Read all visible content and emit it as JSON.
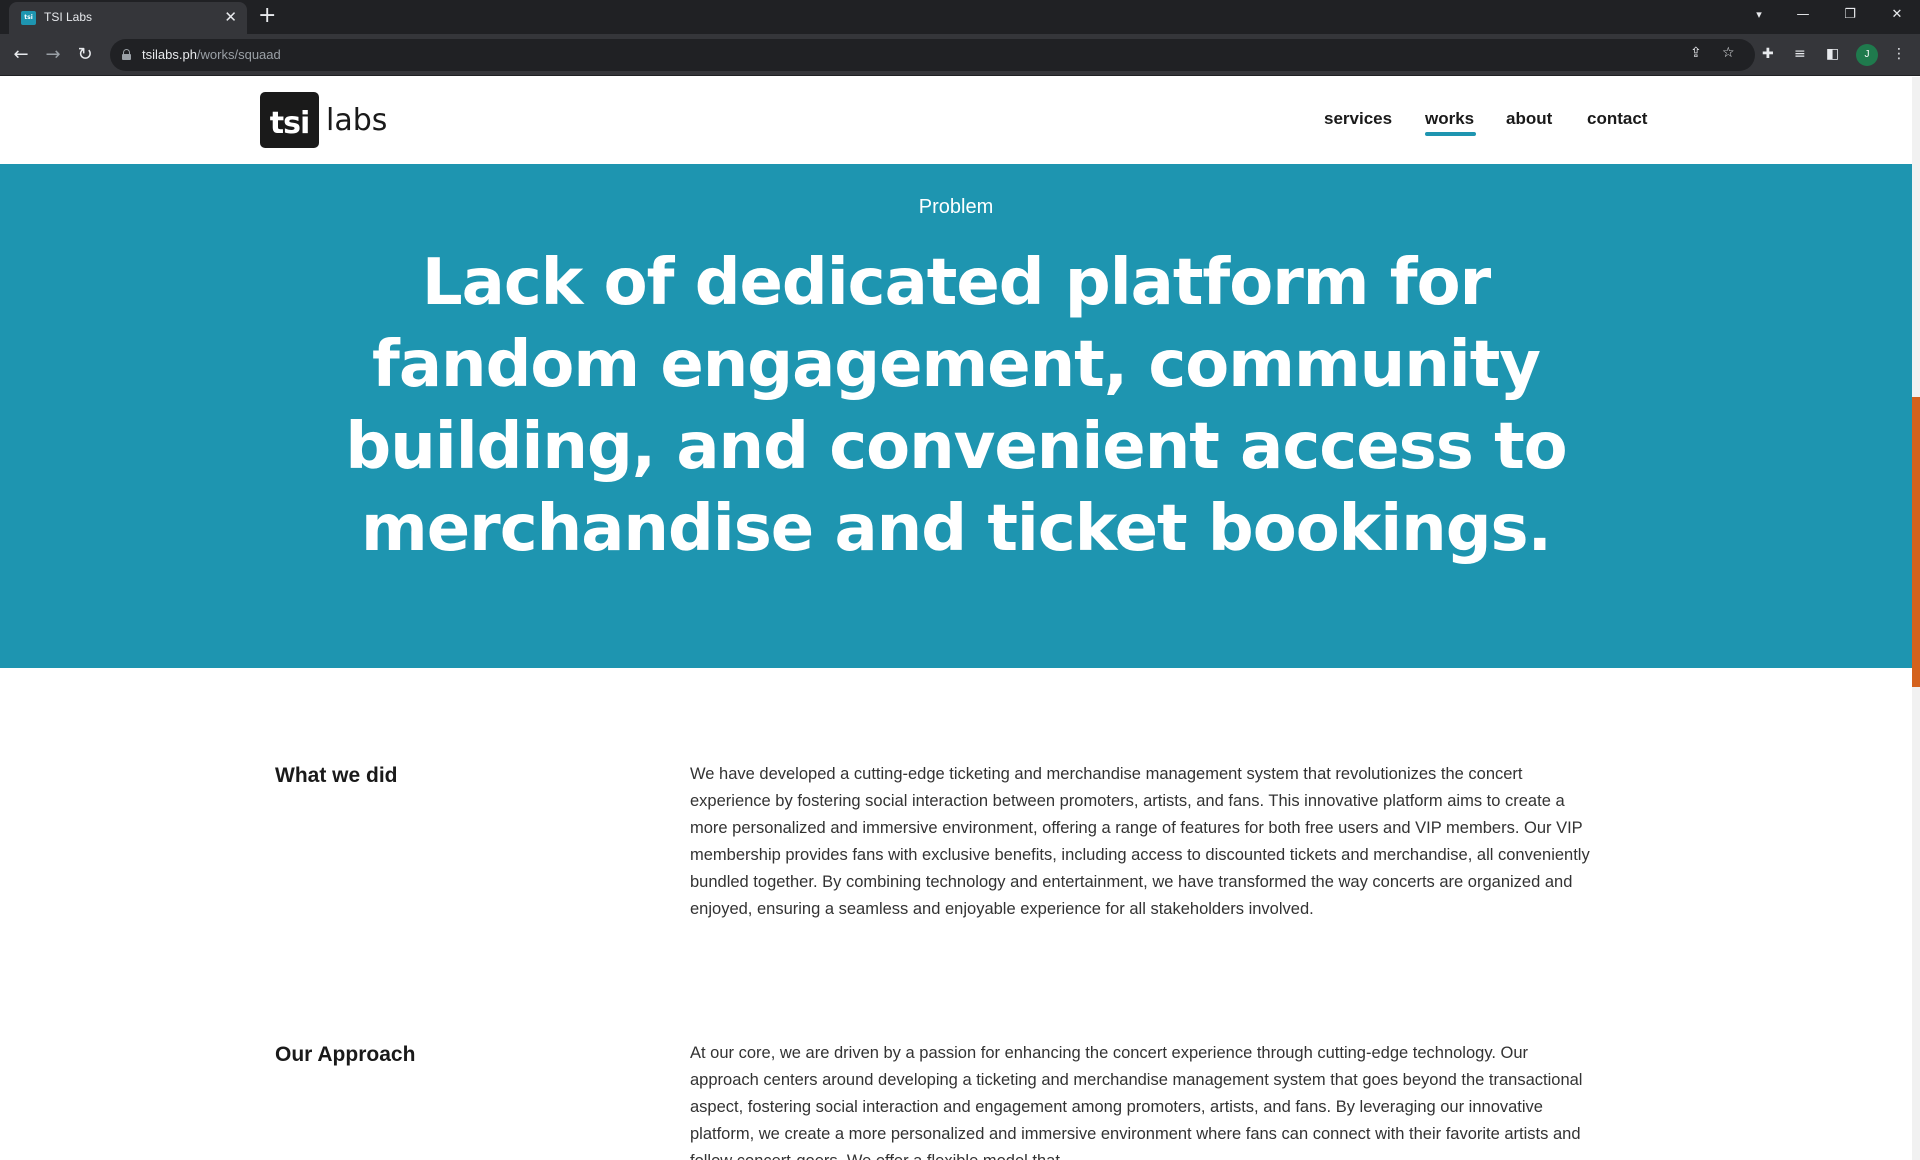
{
  "browser": {
    "tab_title": "TSI Labs",
    "favicon_text": "tsi",
    "url_domain": "tsilabs.ph",
    "url_path": "/works/squaad",
    "profile_initial": "J"
  },
  "header": {
    "logo_mark": "tsi",
    "logo_word": "labs",
    "nav": [
      "services",
      "works",
      "about",
      "contact"
    ],
    "active_nav": "works"
  },
  "hero": {
    "eyebrow": "Problem",
    "title": "Lack of dedicated platform for fandom engagement, community building, and convenient access to merchandise and ticket bookings."
  },
  "sections": [
    {
      "heading": "What we did",
      "body": "We have developed a cutting-edge ticketing and merchandise management system that revolutionizes the concert experience by fostering social interaction between promoters, artists, and fans. This innovative platform aims to create a more personalized and immersive environment, offering a range of features for both free users and VIP members. Our VIP membership provides fans with exclusive benefits, including access to discounted tickets and merchandise, all conveniently bundled together. By combining technology and entertainment, we have transformed the way concerts are organized and enjoyed, ensuring a seamless and enjoyable experience for all stakeholders involved."
    },
    {
      "heading": "Our Approach",
      "body": "At our core, we are driven by a passion for enhancing the concert experience through cutting-edge technology. Our approach centers around developing a ticketing and merchandise management system that goes beyond the transactional aspect, fostering social interaction and engagement among promoters, artists, and fans. By leveraging our innovative platform, we create a more personalized and immersive environment where fans can connect with their favorite artists and follow concert-goers. We offer a flexible model that"
    }
  ],
  "colors": {
    "brand_teal": "#1e95b0",
    "scroll_accent": "#d4621d"
  }
}
